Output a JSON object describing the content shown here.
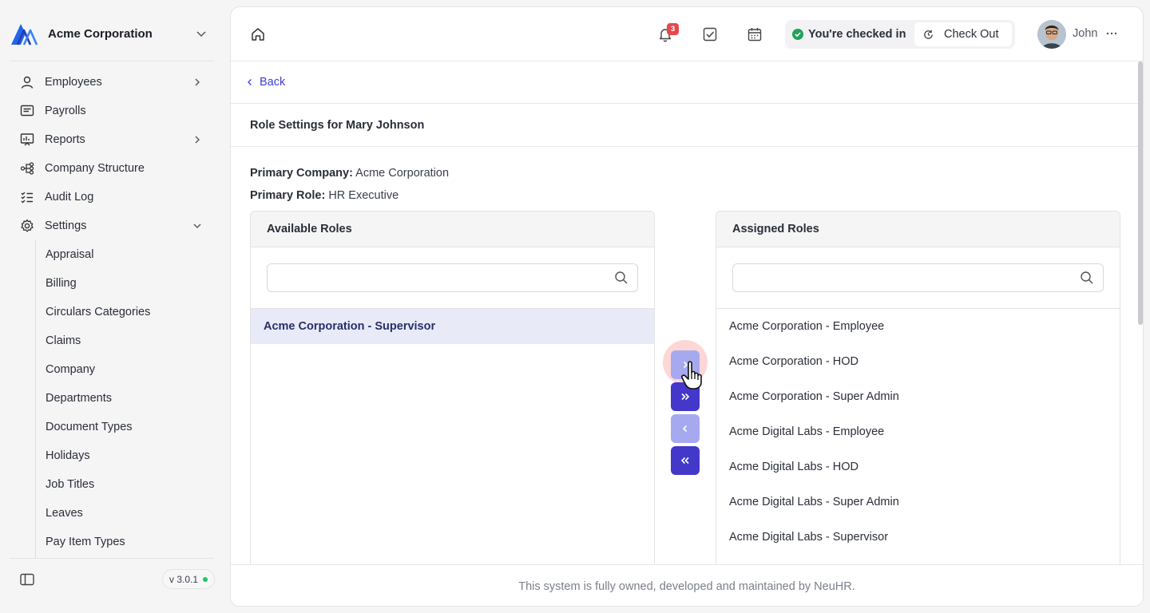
{
  "sidebar": {
    "company": "Acme Corporation",
    "nav": [
      {
        "label": "Employees",
        "icon": "user-icon",
        "has_arrow": true
      },
      {
        "label": "Payrolls",
        "icon": "payroll-icon"
      },
      {
        "label": "Reports",
        "icon": "report-icon",
        "has_arrow": true
      },
      {
        "label": "Company Structure",
        "icon": "hierarchy-icon"
      },
      {
        "label": "Audit Log",
        "icon": "checklist-icon"
      },
      {
        "label": "Settings",
        "icon": "gear-icon",
        "expanded": true
      }
    ],
    "settings_items": [
      "Appraisal",
      "Billing",
      "Circulars Categories",
      "Claims",
      "Company",
      "Departments",
      "Document Types",
      "Holidays",
      "Job Titles",
      "Leaves",
      "Pay Item Types"
    ],
    "version": "v 3.0.1"
  },
  "topbar": {
    "notification_count": "3",
    "checkin_status": "You're checked in",
    "checkout_label": "Check Out",
    "user_name": "John"
  },
  "page": {
    "back_label": "Back",
    "title": "Role Settings for Mary Johnson",
    "primary_company_label": "Primary Company:",
    "primary_company": "Acme Corporation",
    "primary_role_label": "Primary Role:",
    "primary_role": "HR Executive"
  },
  "available": {
    "heading": "Available Roles",
    "search_placeholder": "",
    "roles": [
      "Acme Corporation - Supervisor"
    ],
    "selected_index": 0
  },
  "assigned": {
    "heading": "Assigned Roles",
    "search_placeholder": "",
    "roles": [
      "Acme Corporation - Employee",
      "Acme Corporation - HOD",
      "Acme Corporation - Super Admin",
      "Acme Digital Labs - Employee",
      "Acme Digital Labs - HOD",
      "Acme Digital Labs - Super Admin",
      "Acme Digital Labs - Supervisor"
    ]
  },
  "footer": {
    "text": "This system is fully owned, developed and maintained by NeuHR."
  },
  "colors": {
    "accent": "#4338ca",
    "accent_light": "#a7a9f0",
    "link": "#3b3fd6",
    "success": "#22a35a",
    "badge": "#e5484d"
  }
}
